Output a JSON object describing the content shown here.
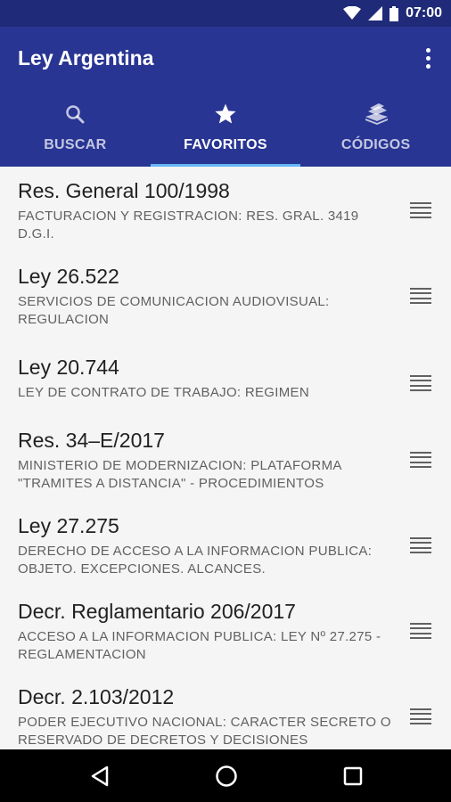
{
  "status_bar": {
    "time": "07:00",
    "icons": [
      "wifi-icon",
      "signal-icon",
      "battery-icon"
    ]
  },
  "app_bar": {
    "title": "Ley Argentina",
    "overflow_icon": "more-vert-icon"
  },
  "tabs": [
    {
      "label": "BUSCAR",
      "icon": "search-icon",
      "active": false
    },
    {
      "label": "FAVORITOS",
      "icon": "star-icon",
      "active": true
    },
    {
      "label": "CÓDIGOS",
      "icon": "books-icon",
      "active": false
    }
  ],
  "favorites": [
    {
      "title": "Res. General 100/1998",
      "subtitle": "FACTURACION Y REGISTRACION: RES. GRAL. 3419 D.G.I."
    },
    {
      "title": "Ley 26.522",
      "subtitle": "SERVICIOS DE COMUNICACION AUDIOVISUAL: REGULACION"
    },
    {
      "title": "Ley 20.744",
      "subtitle": "LEY DE CONTRATO DE TRABAJO: REGIMEN"
    },
    {
      "title": "Res. 34–E/2017",
      "subtitle": "MINISTERIO DE MODERNIZACION: PLATAFORMA \"TRAMITES A DISTANCIA\" - PROCEDIMIENTOS"
    },
    {
      "title": "Ley 27.275",
      "subtitle": "DERECHO DE ACCESO A LA INFORMACION PUBLICA: OBJETO. EXCEPCIONES. ALCANCES."
    },
    {
      "title": "Decr. Reglamentario 206/2017",
      "subtitle": "ACCESO A LA INFORMACION PUBLICA: LEY Nº 27.275 - REGLAMENTACION"
    },
    {
      "title": "Decr. 2.103/2012",
      "subtitle": "PODER EJECUTIVO NACIONAL: CARACTER SECRETO O RESERVADO DE DECRETOS Y DECISIONES"
    }
  ],
  "nav_bar": {
    "buttons": [
      "back-icon",
      "home-icon",
      "recents-icon"
    ]
  },
  "colors": {
    "app_bar": "#283593",
    "status_bar": "#1f2a78",
    "tab_indicator": "#64b5f6",
    "background": "#f5f5f5"
  }
}
